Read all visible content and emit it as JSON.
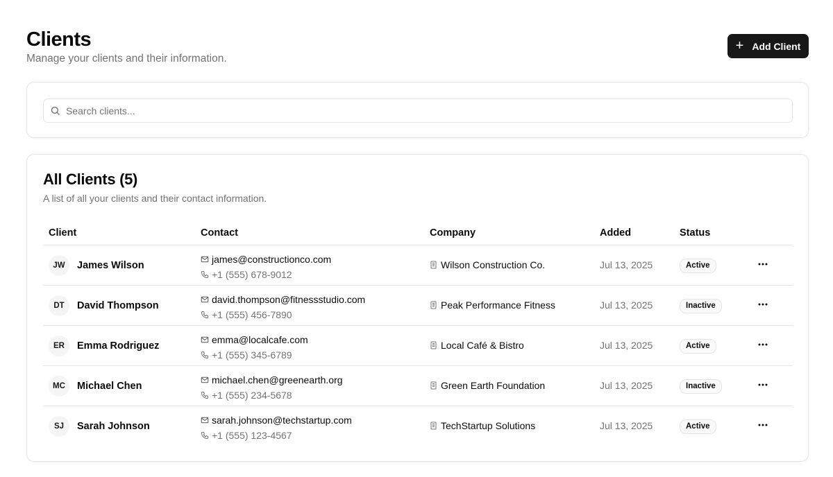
{
  "header": {
    "title": "Clients",
    "subtitle": "Manage your clients and their information.",
    "add_button_label": "Add Client",
    "add_button_icon": "plus-icon"
  },
  "search": {
    "placeholder": "Search clients...",
    "value": "",
    "icon": "search-icon"
  },
  "list": {
    "title": "All Clients (5)",
    "description": "A list of all your clients and their contact information.",
    "columns": [
      "Client",
      "Contact",
      "Company",
      "Added",
      "Status"
    ],
    "rows": [
      {
        "initials": "JW",
        "name": "James Wilson",
        "email": "james@constructionco.com",
        "phone": "+1 (555) 678-9012",
        "company": "Wilson Construction Co.",
        "added": "Jul 13, 2025",
        "status": "Active"
      },
      {
        "initials": "DT",
        "name": "David Thompson",
        "email": "david.thompson@fitnessstudio.com",
        "phone": "+1 (555) 456-7890",
        "company": "Peak Performance Fitness",
        "added": "Jul 13, 2025",
        "status": "Inactive"
      },
      {
        "initials": "ER",
        "name": "Emma Rodriguez",
        "email": "emma@localcafe.com",
        "phone": "+1 (555) 345-6789",
        "company": "Local Café & Bistro",
        "added": "Jul 13, 2025",
        "status": "Active"
      },
      {
        "initials": "MC",
        "name": "Michael Chen",
        "email": "michael.chen@greenearth.org",
        "phone": "+1 (555) 234-5678",
        "company": "Green Earth Foundation",
        "added": "Jul 13, 2025",
        "status": "Inactive"
      },
      {
        "initials": "SJ",
        "name": "Sarah Johnson",
        "email": "sarah.johnson@techstartup.com",
        "phone": "+1 (555) 123-4567",
        "company": "TechStartup Solutions",
        "added": "Jul 13, 2025",
        "status": "Active"
      }
    ]
  },
  "icons": {
    "email": "mail-icon",
    "phone": "phone-icon",
    "company": "building-icon",
    "row_menu": "more-horizontal-icon"
  },
  "colors": {
    "primary_button": "#171717",
    "muted_text": "#737373",
    "border": "#e5e5e5"
  }
}
